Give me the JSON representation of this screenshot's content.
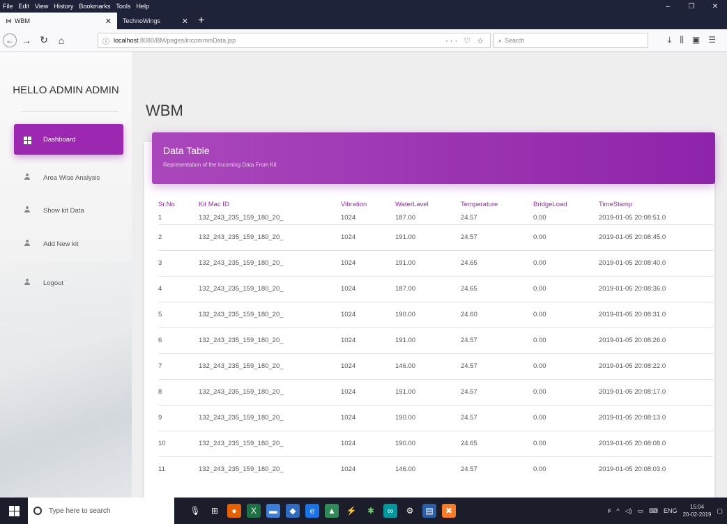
{
  "browser": {
    "menu": [
      "File",
      "Edit",
      "View",
      "History",
      "Bookmarks",
      "Tools",
      "Help"
    ],
    "window_controls": [
      "–",
      "❐",
      "✕"
    ],
    "tabs": [
      {
        "label": "WBM",
        "active": true
      },
      {
        "label": "TechnoWings",
        "active": false
      }
    ],
    "new_tab": "+",
    "url_host": "localhost",
    "url_path": ":8080/BM/pages/incomminData.jsp",
    "url_actions": "··· ♡ ☆",
    "search_placeholder": "Search"
  },
  "sidebar": {
    "brand": "HELLO ADMIN ADMIN",
    "items": [
      {
        "label": "Dashboard",
        "icon": "dashboard-icon",
        "active": true
      },
      {
        "label": "Area Wise Analysis",
        "icon": "person-icon",
        "active": false
      },
      {
        "label": "Show kit Data",
        "icon": "person-icon",
        "active": false
      },
      {
        "label": "Add New kit",
        "icon": "person-icon",
        "active": false
      },
      {
        "label": "Logout",
        "icon": "person-icon",
        "active": false
      }
    ]
  },
  "main": {
    "title": "WBM",
    "card_title": "Data Table",
    "card_subtitle": "Representation of the Incoming Data From Kit",
    "columns": [
      "Sr.No",
      "Kit Mac ID",
      "Vibration",
      "WaterLavel",
      "Temperature",
      "BridgeLoad",
      "TimeStamp"
    ],
    "rows": [
      [
        "1",
        "132_243_235_159_180_20_",
        "1024",
        "187.00",
        "24.57",
        "0.00",
        "2019-01-05 20:08:51.0"
      ],
      [
        "2",
        "132_243_235_159_180_20_",
        "1024",
        "191.00",
        "24.57",
        "0.00",
        "2019-01-05 20:08:45.0"
      ],
      [
        "3",
        "132_243_235_159_180_20_",
        "1024",
        "191.00",
        "24.65",
        "0.00",
        "2019-01-05 20:08:40.0"
      ],
      [
        "4",
        "132_243_235_159_180_20_",
        "1024",
        "187.00",
        "24.65",
        "0.00",
        "2019-01-05 20:08:36.0"
      ],
      [
        "5",
        "132_243_235_159_180_20_",
        "1024",
        "190.00",
        "24.60",
        "0.00",
        "2019-01-05 20:08:31.0"
      ],
      [
        "6",
        "132_243_235_159_180_20_",
        "1024",
        "191.00",
        "24.57",
        "0.00",
        "2019-01-05 20:08:26.0"
      ],
      [
        "7",
        "132_243_235_159_180_20_",
        "1024",
        "146.00",
        "24.57",
        "0.00",
        "2019-01-05 20:08:22.0"
      ],
      [
        "8",
        "132_243_235_159_180_20_",
        "1024",
        "191.00",
        "24.57",
        "0.00",
        "2019-01-05 20:08:17.0"
      ],
      [
        "9",
        "132_243_235_159_180_20_",
        "1024",
        "190.00",
        "24.57",
        "0.00",
        "2019-01-05 20:08:13.0"
      ],
      [
        "10",
        "132_243_235_159_180_20_",
        "1024",
        "190.00",
        "24.65",
        "0.00",
        "2019-01-05 20:08:08.0"
      ],
      [
        "11",
        "132_243_235_159_180_20_",
        "1024",
        "146.00",
        "24.57",
        "0.00",
        "2019-01-05 20:08:03.0"
      ]
    ]
  },
  "taskbar": {
    "search_placeholder": "Type here to search",
    "language": "ENG",
    "time": "15:04",
    "date": "20-02-2019"
  },
  "colors": {
    "accent": "#9c27b0",
    "chrome": "#1f2339",
    "taskbar": "#1b1d2b"
  }
}
